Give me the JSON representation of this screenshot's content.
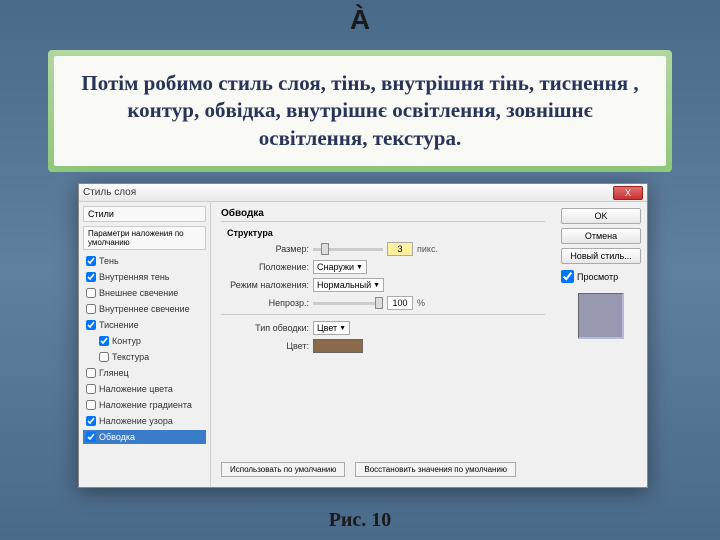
{
  "top_symbol": "À",
  "banner_text": "Потім робимо стиль слоя, тінь, внутрішня тінь, тиснення , контур, обвідка, внутрішнє освітлення, зовнішнє освітлення, текстура.",
  "caption": "Рис. 10",
  "dialog": {
    "title": "Стиль слоя",
    "close": "X",
    "styles_header": "Стили",
    "params_header": "Параметри наложения по умолчанию",
    "items": [
      {
        "label": "Тень",
        "checked": true
      },
      {
        "label": "Внутренняя тень",
        "checked": true
      },
      {
        "label": "Внешнее свечение",
        "checked": false
      },
      {
        "label": "Внутреннее свечение",
        "checked": false
      },
      {
        "label": "Тиснение",
        "checked": true
      },
      {
        "label": "Контур",
        "checked": true,
        "indent": true
      },
      {
        "label": "Текстура",
        "checked": false,
        "indent": true
      },
      {
        "label": "Глянец",
        "checked": false
      },
      {
        "label": "Наложение цвета",
        "checked": false
      },
      {
        "label": "Наложение градиента",
        "checked": false
      },
      {
        "label": "Наложение узора",
        "checked": true
      },
      {
        "label": "Обводка",
        "checked": true,
        "selected": true
      }
    ],
    "mid": {
      "group": "Обводка",
      "sub": "Структура",
      "size_lbl": "Размер:",
      "size_val": "3",
      "size_unit": "пикс.",
      "pos_lbl": "Положение:",
      "pos_val": "Снаружи",
      "blend_lbl": "Режим наложения:",
      "blend_val": "Нормальный",
      "opacity_lbl": "Непрозр.:",
      "opacity_val": "100",
      "opacity_unit": "%",
      "stroke_type_lbl": "Тип обводки:",
      "stroke_type_val": "Цвет",
      "color_lbl": "Цвет:",
      "btn_default": "Использовать по умолчанию",
      "btn_reset": "Восстановить значения по умолчанию"
    },
    "right": {
      "ok": "OK",
      "cancel": "Отмена",
      "new_style": "Новый стиль...",
      "preview": "Просмотр"
    }
  }
}
